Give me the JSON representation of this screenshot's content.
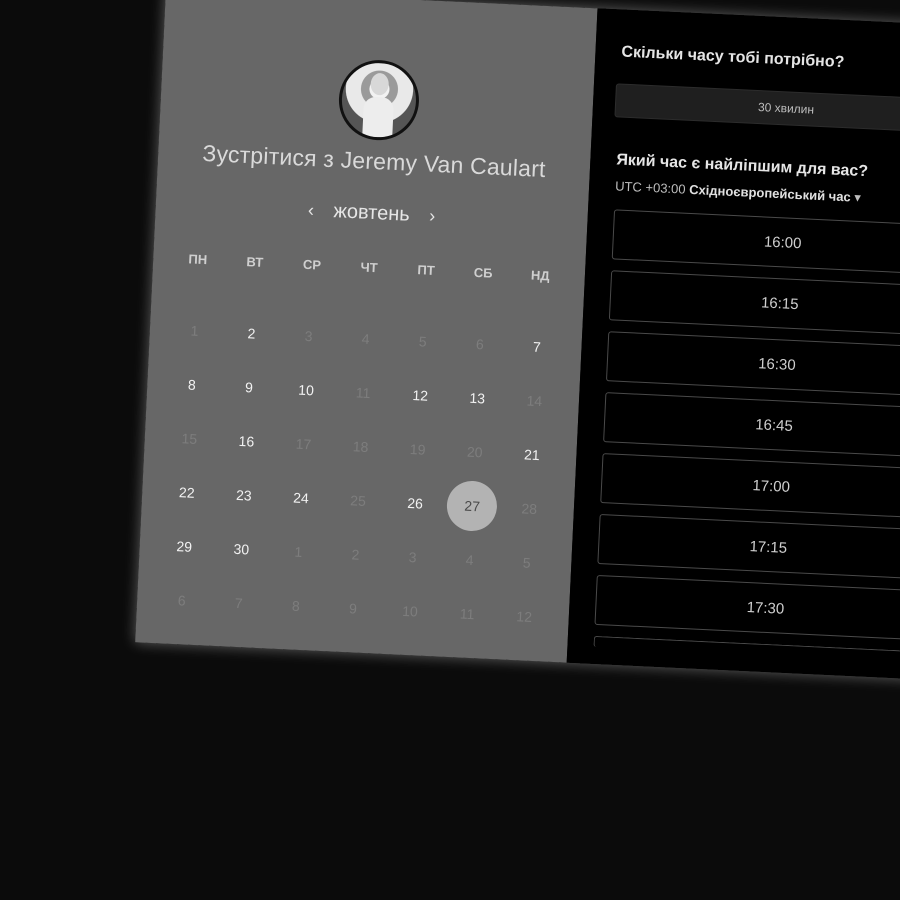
{
  "host": {
    "title_prefix": "Зустрітися з",
    "name": "Jeremy Van Caulart"
  },
  "calendar": {
    "month": "жовтень",
    "prev_arrow": "‹",
    "next_arrow": "›",
    "weekdays": [
      "ПН",
      "ВТ",
      "СР",
      "ЧТ",
      "ПТ",
      "СБ",
      "НД"
    ],
    "days": [
      {
        "label": "1",
        "enabled": false
      },
      {
        "label": "2",
        "enabled": true
      },
      {
        "label": "3",
        "enabled": false
      },
      {
        "label": "4",
        "enabled": false
      },
      {
        "label": "5",
        "enabled": false
      },
      {
        "label": "6",
        "enabled": false
      },
      {
        "label": "7",
        "enabled": true
      },
      {
        "label": "8",
        "enabled": true
      },
      {
        "label": "9",
        "enabled": true
      },
      {
        "label": "10",
        "enabled": true
      },
      {
        "label": "11",
        "enabled": false
      },
      {
        "label": "12",
        "enabled": true
      },
      {
        "label": "13",
        "enabled": true
      },
      {
        "label": "14",
        "enabled": false
      },
      {
        "label": "15",
        "enabled": false
      },
      {
        "label": "16",
        "enabled": true
      },
      {
        "label": "17",
        "enabled": false
      },
      {
        "label": "18",
        "enabled": false
      },
      {
        "label": "19",
        "enabled": false
      },
      {
        "label": "20",
        "enabled": false
      },
      {
        "label": "21",
        "enabled": true
      },
      {
        "label": "22",
        "enabled": true
      },
      {
        "label": "23",
        "enabled": true
      },
      {
        "label": "24",
        "enabled": true
      },
      {
        "label": "25",
        "enabled": false
      },
      {
        "label": "26",
        "enabled": true
      },
      {
        "label": "27",
        "enabled": true,
        "selected": true
      },
      {
        "label": "28",
        "enabled": false
      },
      {
        "label": "29",
        "enabled": true
      },
      {
        "label": "30",
        "enabled": true
      },
      {
        "label": "1",
        "enabled": false
      },
      {
        "label": "2",
        "enabled": false
      },
      {
        "label": "3",
        "enabled": false
      },
      {
        "label": "4",
        "enabled": false
      },
      {
        "label": "5",
        "enabled": false
      },
      {
        "label": "6",
        "enabled": false
      },
      {
        "label": "7",
        "enabled": false
      },
      {
        "label": "8",
        "enabled": false
      },
      {
        "label": "9",
        "enabled": false
      },
      {
        "label": "10",
        "enabled": false
      },
      {
        "label": "11",
        "enabled": false
      },
      {
        "label": "12",
        "enabled": false
      }
    ]
  },
  "booking": {
    "duration_question": "Скільки часу тобі потрібно?",
    "duration_value": "30 хвилин",
    "time_question": "Який час є найліпшим для вас?",
    "timezone_offset": "UTC +03:00",
    "timezone_name": "Східноєвропейський час",
    "timezone_caret": "▾",
    "slots": [
      "16:00",
      "16:15",
      "16:30",
      "16:45",
      "17:00",
      "17:15",
      "17:30"
    ]
  },
  "colors": {
    "left_panel": "#676767",
    "right_panel": "#000000",
    "selected_day": "#b3b3b3"
  }
}
